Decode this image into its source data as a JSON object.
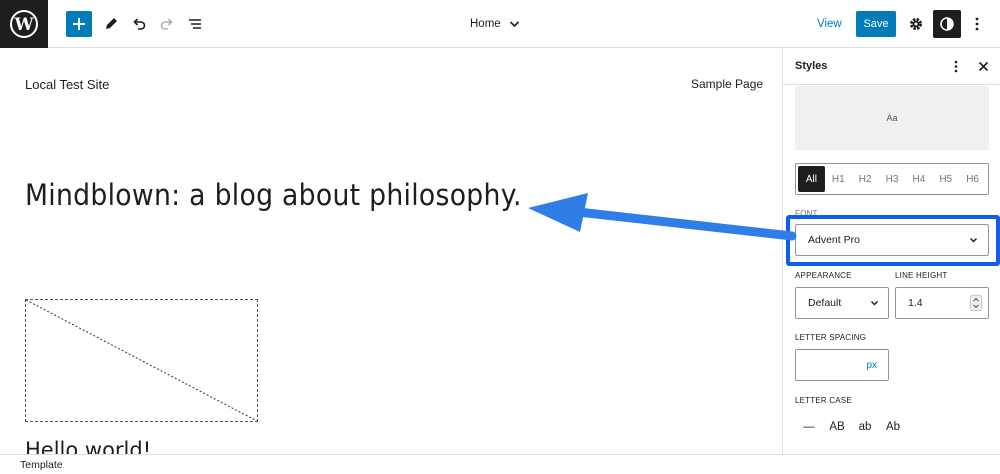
{
  "colors": {
    "accent": "#007cba",
    "highlight": "#0f5fe8",
    "dark": "#1e1e1e"
  },
  "toolbar": {
    "logo_icon": "wordpress-logo-icon",
    "add_icon": "plus-icon",
    "tools_icon": "pencil-icon",
    "undo_icon": "undo-icon",
    "redo_icon": "redo-icon",
    "list_view_icon": "list-view-icon",
    "document_title": "Home",
    "view_label": "View",
    "save_label": "Save",
    "settings_icon": "gear-icon",
    "styles_icon": "half-circle-contrast-icon",
    "options_icon": "vertical-ellipsis-icon"
  },
  "canvas": {
    "site_title": "Local Test Site",
    "nav_link": "Sample Page",
    "hero_heading": "Mindblown: a blog about philosophy.",
    "post_title": "Hello world!"
  },
  "sidebar": {
    "title": "Styles",
    "preview_text": "Aa",
    "element_levels": [
      "All",
      "H1",
      "H2",
      "H3",
      "H4",
      "H5",
      "H6"
    ],
    "active_level": "All",
    "font_label": "FONT",
    "font_value": "Advent Pro",
    "appearance_label": "APPEARANCE",
    "appearance_value": "Default",
    "line_height_label": "LINE HEIGHT",
    "line_height_value": "1.4",
    "letter_spacing_label": "LETTER SPACING",
    "letter_spacing_unit": "px",
    "letter_case_label": "LETTER CASE",
    "letter_case_options": [
      "—",
      "AB",
      "ab",
      "Ab"
    ]
  },
  "footer": {
    "label": "Template"
  }
}
